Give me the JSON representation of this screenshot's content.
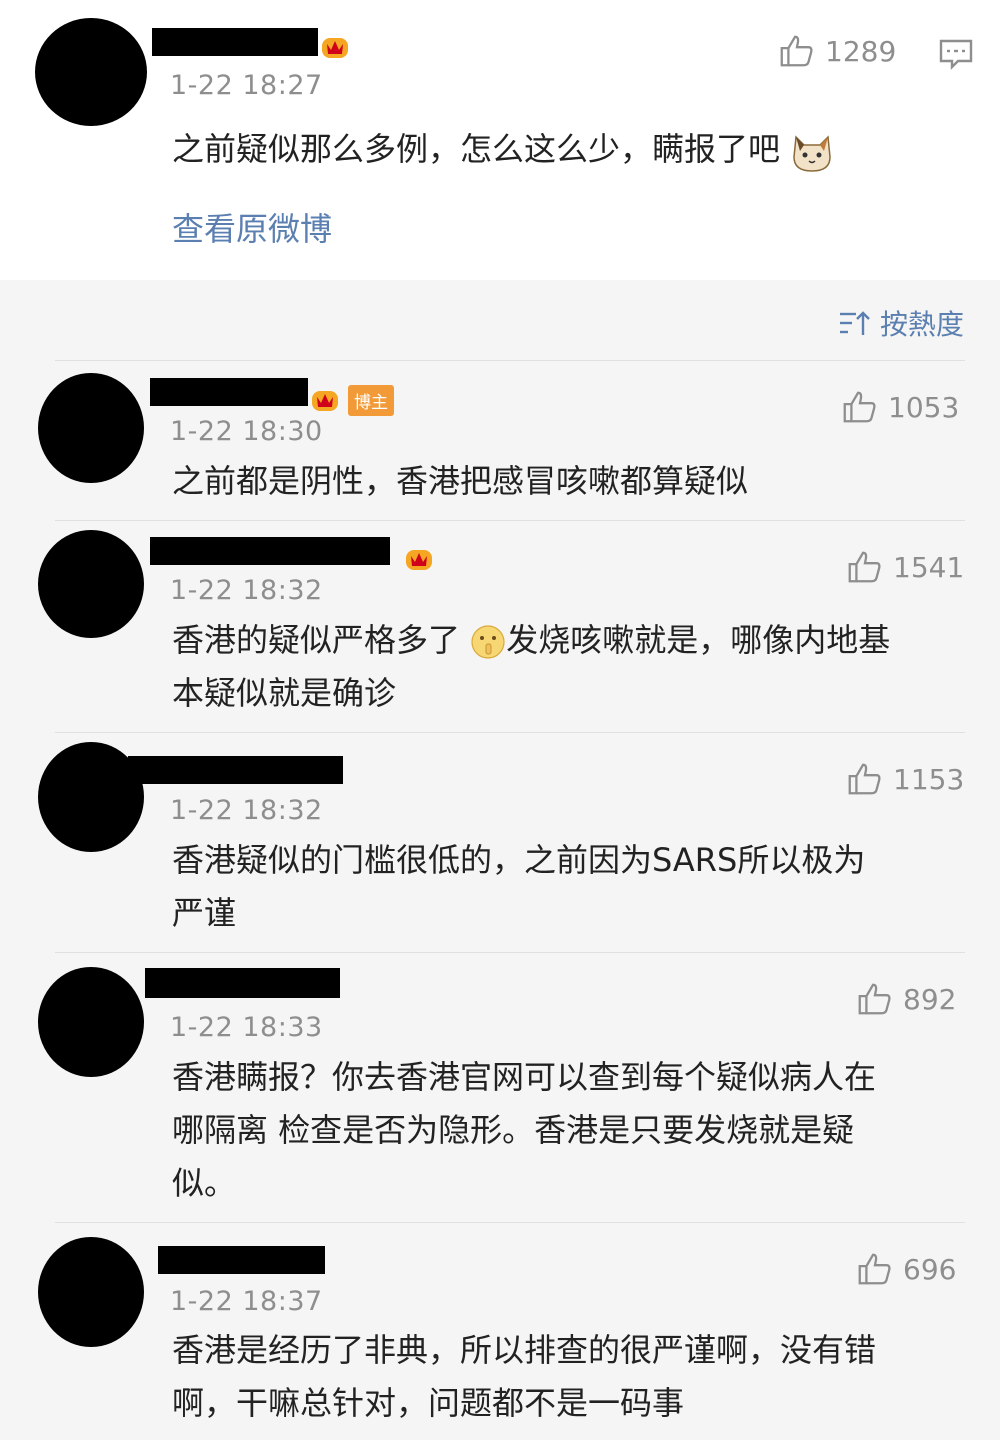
{
  "main_post": {
    "time": "1-22 18:27",
    "likes": "1289",
    "text": "之前疑似那么多例，怎么这么少，瞒报了吧",
    "view_original": "查看原微博"
  },
  "sort_label": "按熱度",
  "comments": [
    {
      "time": "1-22 18:30",
      "likes": "1053",
      "tag": "博主",
      "lines": [
        "之前都是阴性，香港把感冒咳嗽都算疑似"
      ]
    },
    {
      "time": "1-22 18:32",
      "likes": "1541",
      "lines": [
        "香港的疑似严格多了",
        "发烧咳嗽就是，哪像内地基",
        "本疑似就是确诊"
      ]
    },
    {
      "time": "1-22 18:32",
      "likes": "1153",
      "lines": [
        "香港疑似的门槛很低的，之前因为SARS所以极为",
        "严谨"
      ]
    },
    {
      "time": "1-22 18:33",
      "likes": "892",
      "lines": [
        "香港瞒报？你去香港官网可以查到每个疑似病人在",
        "哪隔离 检查是否为隐形。香港是只要发烧就是疑",
        "似。"
      ]
    },
    {
      "time": "1-22 18:37",
      "likes": "696",
      "lines": [
        "香港是经历了非典，所以排查的很严谨啊，没有错",
        "啊，干嘛总针对，问题都不是一码事"
      ]
    }
  ],
  "colors": {
    "link": "#5b7fb0",
    "meta": "#8e8e8e",
    "tag": "#f29a38"
  }
}
